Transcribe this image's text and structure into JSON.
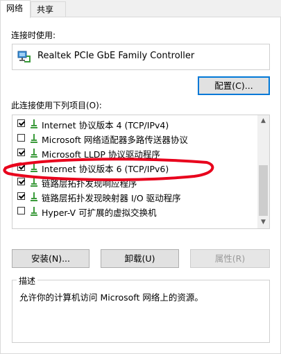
{
  "tabs": [
    {
      "label": "网络",
      "active": true
    },
    {
      "label": "共享",
      "active": false
    }
  ],
  "connect_using_label": "连接时使用:",
  "adapter": {
    "name": "Realtek PCIe GbE Family Controller",
    "icon": "network-adapter-icon"
  },
  "configure_button": "配置(C)...",
  "items_label": "此连接使用下列项目(O):",
  "items": [
    {
      "label": "Internet 协议版本 4 (TCP/IPv4)",
      "checked": true
    },
    {
      "label": "Microsoft 网络适配器多路传送器协议",
      "checked": false
    },
    {
      "label": "Microsoft LLDP 协议驱动程序",
      "checked": true
    },
    {
      "label": "Internet 协议版本 6 (TCP/IPv6)",
      "checked": true
    },
    {
      "label": "链路层拓扑发现响应程序",
      "checked": true
    },
    {
      "label": "链路层拓扑发现映射器 I/O 驱动程序",
      "checked": true
    },
    {
      "label": "Hyper-V 可扩展的虚拟交换机",
      "checked": false
    }
  ],
  "buttons": {
    "install": "安装(N)...",
    "uninstall": "卸载(U)",
    "properties": "属性(R)"
  },
  "description": {
    "title": "描述",
    "text": "允许你的计算机访问 Microsoft 网络上的资源。"
  },
  "colors": {
    "annotation": "#e8001c",
    "focus": "#0078d7",
    "protocol_icon": "#3a9a3a"
  }
}
